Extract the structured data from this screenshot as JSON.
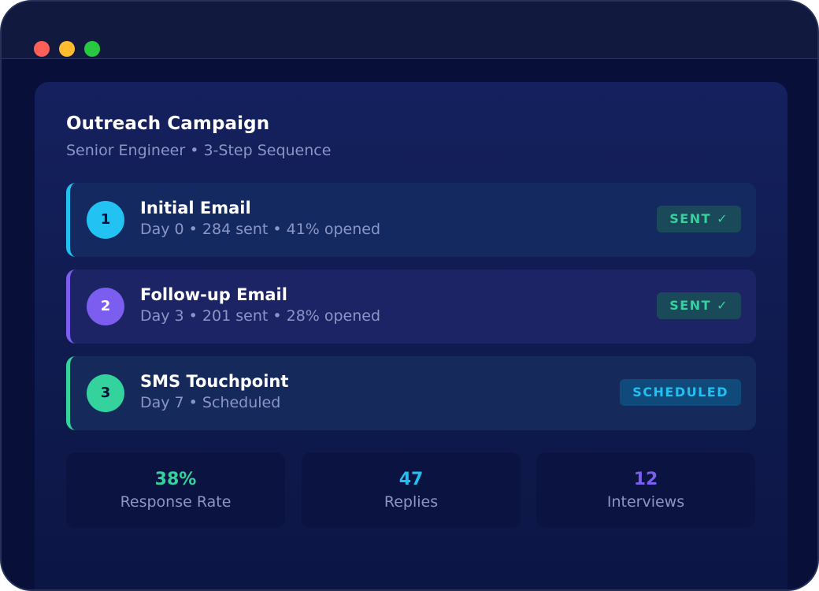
{
  "window": {
    "controls": [
      "close",
      "minimize",
      "maximize"
    ]
  },
  "campaign": {
    "title": "Outreach Campaign",
    "subtitle": "Senior Engineer • 3-Step Sequence"
  },
  "steps": [
    {
      "number": "1",
      "title": "Initial Email",
      "meta": "Day 0 • 284 sent • 41% opened",
      "status": "SENT ✓",
      "accent": "#21c0f1"
    },
    {
      "number": "2",
      "title": "Follow-up Email",
      "meta": "Day 3 • 201 sent • 28% opened",
      "status": "SENT ✓",
      "accent": "#7b5ef0"
    },
    {
      "number": "3",
      "title": "SMS Touchpoint",
      "meta": "Day 7 • Scheduled",
      "status": "SCHEDULED",
      "accent": "#34d29d"
    }
  ],
  "stats": [
    {
      "value": "38%",
      "label": "Response Rate",
      "color": "#34d29d"
    },
    {
      "value": "47",
      "label": "Replies",
      "color": "#21c0f1"
    },
    {
      "value": "12",
      "label": "Interviews",
      "color": "#7b5ef0"
    }
  ]
}
